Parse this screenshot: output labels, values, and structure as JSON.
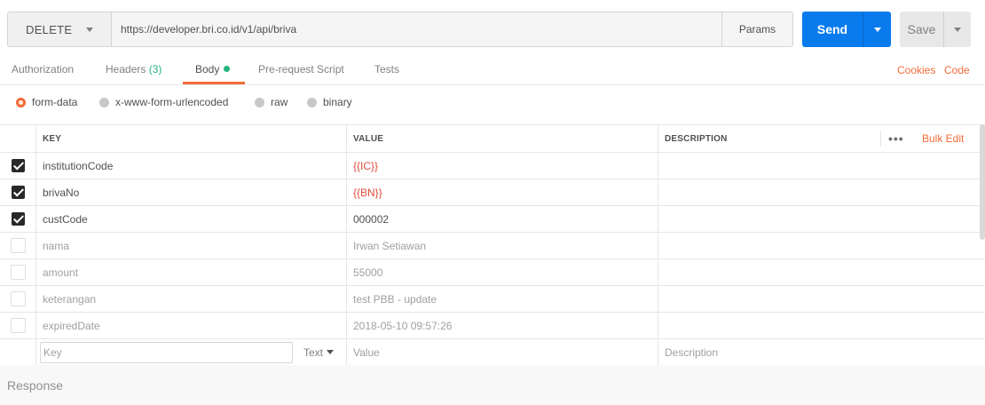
{
  "request": {
    "method": "DELETE",
    "url": "https://developer.bri.co.id/v1/api/briva",
    "params_label": "Params",
    "send_label": "Send",
    "save_label": "Save"
  },
  "tabs": {
    "authorization": "Authorization",
    "headers": "Headers",
    "headers_count": "(3)",
    "body": "Body",
    "pre_request": "Pre-request Script",
    "tests": "Tests",
    "cookies": "Cookies",
    "code": "Code"
  },
  "body_modes": [
    "form-data",
    "x-www-form-urlencoded",
    "raw",
    "binary"
  ],
  "body_mode_selected": "form-data",
  "table": {
    "headers": {
      "key": "KEY",
      "value": "VALUE",
      "description": "DESCRIPTION",
      "bulk_edit": "Bulk Edit",
      "more": "•••"
    },
    "rows": [
      {
        "key": "institutionCode",
        "value": "{{IC}}",
        "description": "",
        "enabled": true
      },
      {
        "key": "brivaNo",
        "value": "{{BN}}",
        "description": "",
        "enabled": true
      },
      {
        "key": "custCode",
        "value": "000002",
        "description": "",
        "enabled": true
      },
      {
        "key": "nama",
        "value": "Irwan Setiawan",
        "description": "",
        "enabled": false
      },
      {
        "key": "amount",
        "value": "55000",
        "description": "",
        "enabled": false
      },
      {
        "key": "keterangan",
        "value": "test PBB - update",
        "description": "",
        "enabled": false
      },
      {
        "key": "expiredDate",
        "value": "2018-05-10 09:57:26",
        "description": "",
        "enabled": false
      }
    ],
    "new_row": {
      "key_placeholder": "Key",
      "type": "Text",
      "value_placeholder": "Value",
      "description_placeholder": "Description"
    }
  },
  "response": {
    "label": "Response"
  },
  "colors": {
    "accent": "#f26b3a",
    "send": "#097bed",
    "variable": "#e04c3c",
    "indicator": "#26b47f"
  }
}
